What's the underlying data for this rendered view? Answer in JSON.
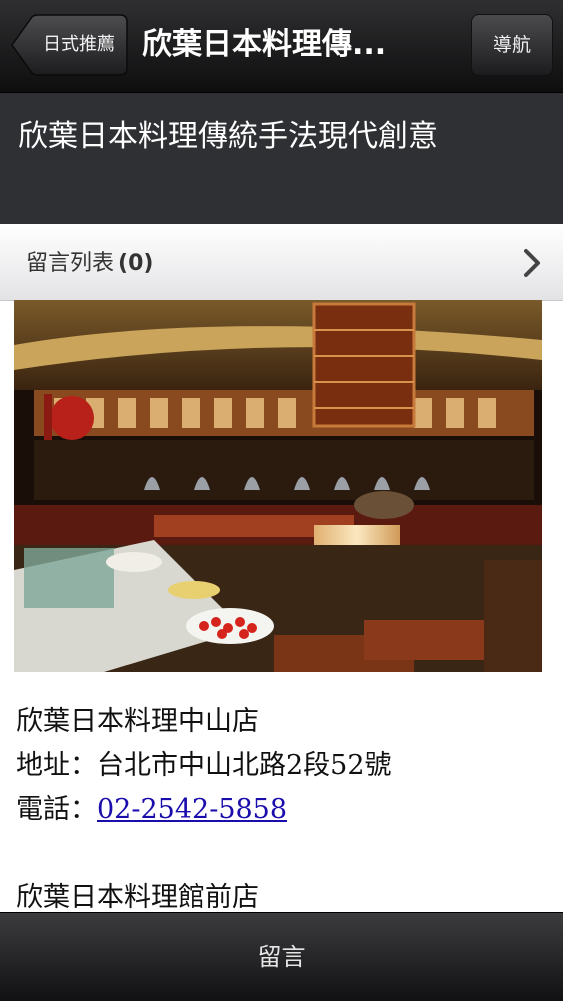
{
  "navbar": {
    "back_label": "日式推薦",
    "title": "欣葉日本料理傳...",
    "right_label": "導航"
  },
  "header": {
    "title": "欣葉日本料理傳統手法現代創意"
  },
  "comments": {
    "label": "留言列表",
    "count": "(0)"
  },
  "photo": {
    "icon": "restaurant-photo"
  },
  "stores": [
    {
      "name": "欣葉日本料理中山店",
      "address": "地址：台北市中山北路2段52號",
      "phone_prefix": "電話：",
      "phone": "02-2542-5858"
    },
    {
      "name": "欣葉日本料理館前店"
    }
  ],
  "bottom_bar": {
    "label": "留言"
  },
  "colors": {
    "navbar": "#1e1e20",
    "header_band": "#2f3033",
    "link": "#1a0dab"
  }
}
